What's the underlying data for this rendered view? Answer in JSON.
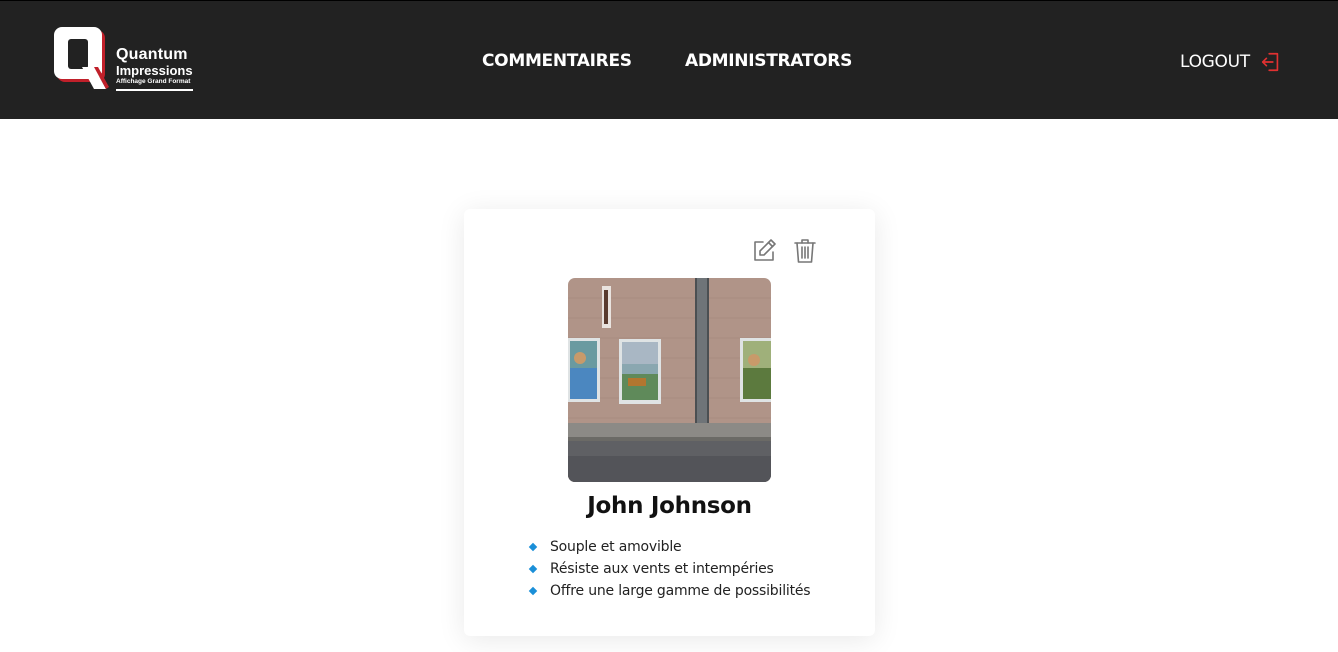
{
  "header": {
    "logo": {
      "line1": "Quantum",
      "line2": "Impressions",
      "line3": "Affichage Grand Format"
    },
    "nav": [
      {
        "label": "COMMENTAIRES"
      },
      {
        "label": "ADMINISTRATORS"
      }
    ],
    "logout_label": "LOGOUT",
    "logout_icon": "logout-icon"
  },
  "card": {
    "edit_icon": "edit-icon",
    "delete_icon": "trash-icon",
    "image_alt": "storefront photo",
    "name": "John Johnson",
    "features": [
      "Souple et amovible",
      "Résiste aux vents et intempéries",
      "Offre une large gamme de possibilités"
    ]
  },
  "colors": {
    "header_bg": "#222222",
    "accent_red": "#e03131",
    "bullet_blue": "#1a8fd8"
  }
}
